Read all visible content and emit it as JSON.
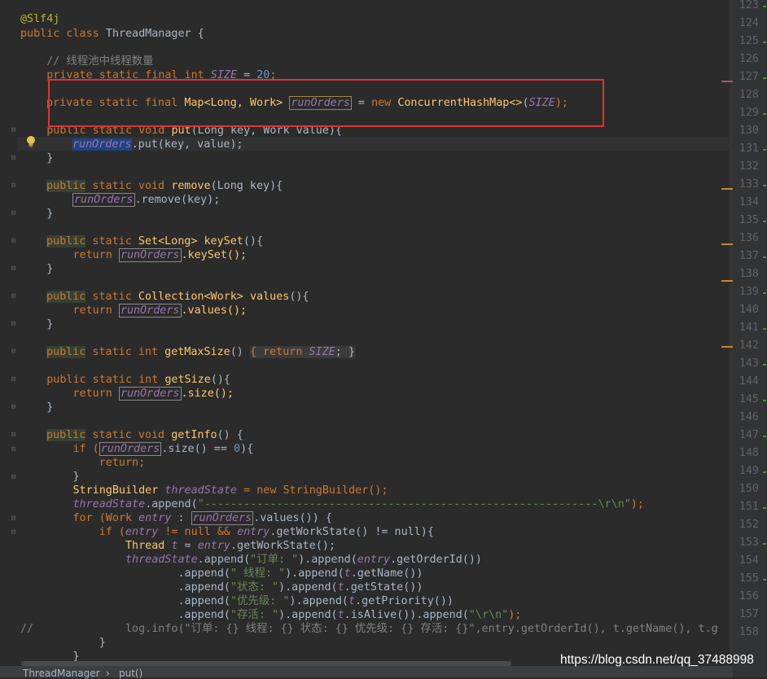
{
  "editor": {
    "lines": {
      "l1": "@Slf4j",
      "l2a": "public class ",
      "l2b": "ThreadManager",
      "l2c": " {",
      "l3": "    // 线程池中线程数量",
      "l4a": "    private static final int ",
      "l4b": "SIZE",
      "l4c": " = ",
      "l4d": "20",
      "l4e": ";",
      "l5a": "private static final ",
      "l5b": "Map<Long, Work> ",
      "l5c": "runOrders",
      "l5d": " = ",
      "l5e": "new ",
      "l5f": "ConcurrentHashMap<>",
      "l5g": "(",
      "l5h": "SIZE",
      "l5i": ");",
      "l6a": "    public static void ",
      "l6b": "put",
      "l6c": "(Long key, Work value){",
      "l7a": "runOrders",
      "l7b": ".put(key, value);",
      "l8": "    }",
      "l9a": "public",
      "l9b": " static void ",
      "l9c": "remove",
      "l9d": "(Long key){",
      "l10a": "runOrders",
      "l10b": ".remove(key);",
      "l11": "    }",
      "l12a": "public",
      "l12b": " static ",
      "l12c": "Set<Long> ",
      "l12d": "keySet",
      "l12e": "(){",
      "l13a": "        return ",
      "l13b": "runOrders",
      "l13c": ".keySet();",
      "l14": "    }",
      "l15a": "public",
      "l15b": " static ",
      "l15c": "Collection<Work> ",
      "l15d": "values",
      "l15e": "(){",
      "l16a": "        return ",
      "l16b": "runOrders",
      "l16c": ".values();",
      "l17": "    }",
      "l18a": "public",
      "l18b": " static int ",
      "l18c": "getMaxSize",
      "l18d": "() ",
      "l18e": "{ return ",
      "l18f": "SIZE",
      "l18g": "; }",
      "l19a": "    public static int ",
      "l19b": "getSize",
      "l19c": "(){",
      "l20a": "        return ",
      "l20b": "runOrders",
      "l20c": ".size();",
      "l21": "    }",
      "l22a": "public",
      "l22b": " static void ",
      "l22c": "getInfo",
      "l22d": "() {",
      "l23a": "        if (",
      "l23b": "runOrders",
      "l23c": ".size() == ",
      "l23d": "0",
      "l23e": "){",
      "l24": "            return;",
      "l25": "        }",
      "l26a": "        StringBuilder ",
      "l26b": "threadState",
      "l26c": " = new StringBuilder();",
      "l27a": "        threadState",
      "l27b": ".append(",
      "l27c": "\"------------------------------------------------------------\\r\\n\"",
      "l27d": ");",
      "l28a": "        for (Work ",
      "l28b": "entry",
      "l28c": " : ",
      "l28d": "runOrders",
      "l28e": ".values()) {",
      "l29a": "            if (",
      "l29b": "entry",
      "l29c": " != null && ",
      "l29d": "entry",
      "l29e": ".getWorkState() != null){",
      "l30a": "                Thread ",
      "l30b": "t",
      "l30c": " = ",
      "l30d": "entry",
      "l30e": ".getWorkState();",
      "l31a": "                threadState",
      "l31b": ".append(",
      "l31c": "\"订单: \"",
      "l31d": ").append(",
      "l31e": "entry",
      "l31f": ".getOrderId())",
      "l32a": "                        .append(",
      "l32b": "\" 线程: \"",
      "l32c": ").append(",
      "l32d": "t",
      "l32e": ".getName())",
      "l33a": "                        .append(",
      "l33b": "\"状态: \"",
      "l33c": ").append(",
      "l33d": "t",
      "l33e": ".getState())",
      "l34a": "                        .append(",
      "l34b": "\"优先级: \"",
      "l34c": ").append(",
      "l34d": "t",
      "l34e": ".getPriority())",
      "l35a": "                        .append(",
      "l35b": "\"存活: \"",
      "l35c": ").append(",
      "l35d": "t",
      "l35e": ".isAlive()).append(",
      "l35f": "\"\\r\\n\"",
      "l35g": ");",
      "l36": "//              log.info(\"订单: {} 线程: {} 状态: {} 优先级: {} 存活: {}\",entry.getOrderId(), t.getName(), t.g",
      "l37": "            }",
      "l38": "        }"
    }
  },
  "line_numbers": [
    "123",
    "124",
    "125",
    "126",
    "127",
    "128",
    "129",
    "130",
    "131",
    "132",
    "133",
    "134",
    "135",
    "136",
    "137",
    "138",
    "139",
    "140",
    "141",
    "142",
    "143",
    "144",
    "145",
    "146",
    "147",
    "148",
    "149",
    "150",
    "151",
    "152",
    "153",
    "154",
    "155",
    "156",
    "157",
    "158"
  ],
  "breadcrumb": {
    "class": "ThreadManager",
    "sep": "›",
    "method": "put()"
  },
  "watermark": "https://blog.csdn.net/qq_37488998",
  "colors": {
    "highlight_box": "#e03333",
    "background": "#2b2b2b",
    "keyword": "#cc7832"
  }
}
